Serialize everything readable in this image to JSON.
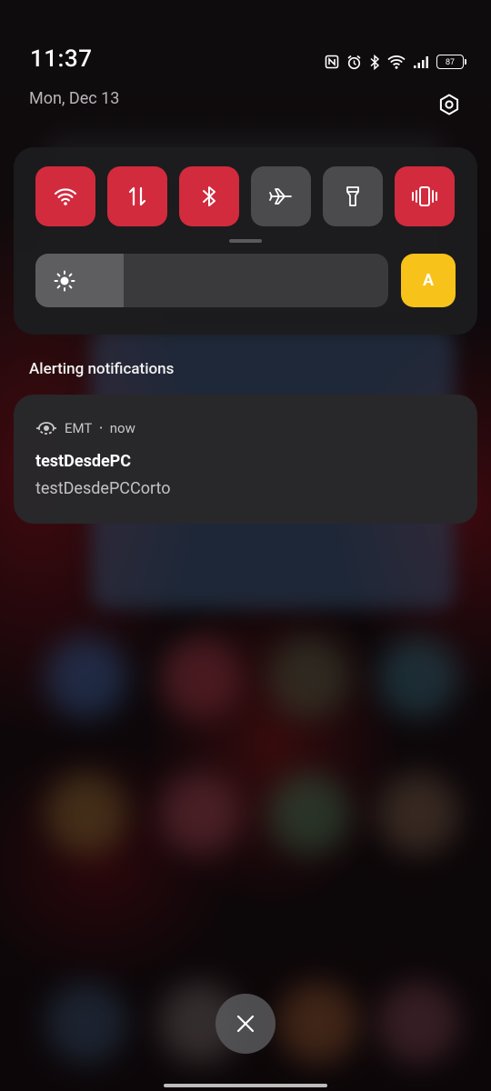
{
  "status_bar": {
    "time": "11:37",
    "battery_level": "87",
    "icons": [
      "nfc-icon",
      "alarm-icon",
      "bluetooth-icon",
      "wifi-icon",
      "cellular-signal-icon",
      "battery-icon"
    ]
  },
  "header": {
    "date": "Mon, Dec 13",
    "settings_icon": "gear-icon"
  },
  "quick_settings": {
    "tiles": [
      {
        "name": "wifi",
        "icon": "wifi-icon",
        "active": true
      },
      {
        "name": "mobile-data",
        "icon": "mobile-data-icon",
        "active": true
      },
      {
        "name": "bluetooth",
        "icon": "bluetooth-icon",
        "active": true
      },
      {
        "name": "airplane-mode",
        "icon": "airplane-icon",
        "active": false
      },
      {
        "name": "flashlight",
        "icon": "flashlight-icon",
        "active": false
      },
      {
        "name": "vibrate",
        "icon": "vibrate-icon",
        "active": true
      }
    ],
    "brightness_level": 0.25,
    "auto_brightness_label": "A"
  },
  "colors": {
    "tile_active": "#d22b3d",
    "tile_inactive": "#4b4b4d",
    "auto_brightness": "#f7c21a",
    "panel_bg": "#1c1c1e"
  },
  "notifications": {
    "section_title": "Alerting notifications",
    "items": [
      {
        "app_name": "EMT",
        "time": "now",
        "title": "testDesdePC",
        "text": "testDesdePCCorto"
      }
    ]
  },
  "clear_all_icon": "close-icon"
}
